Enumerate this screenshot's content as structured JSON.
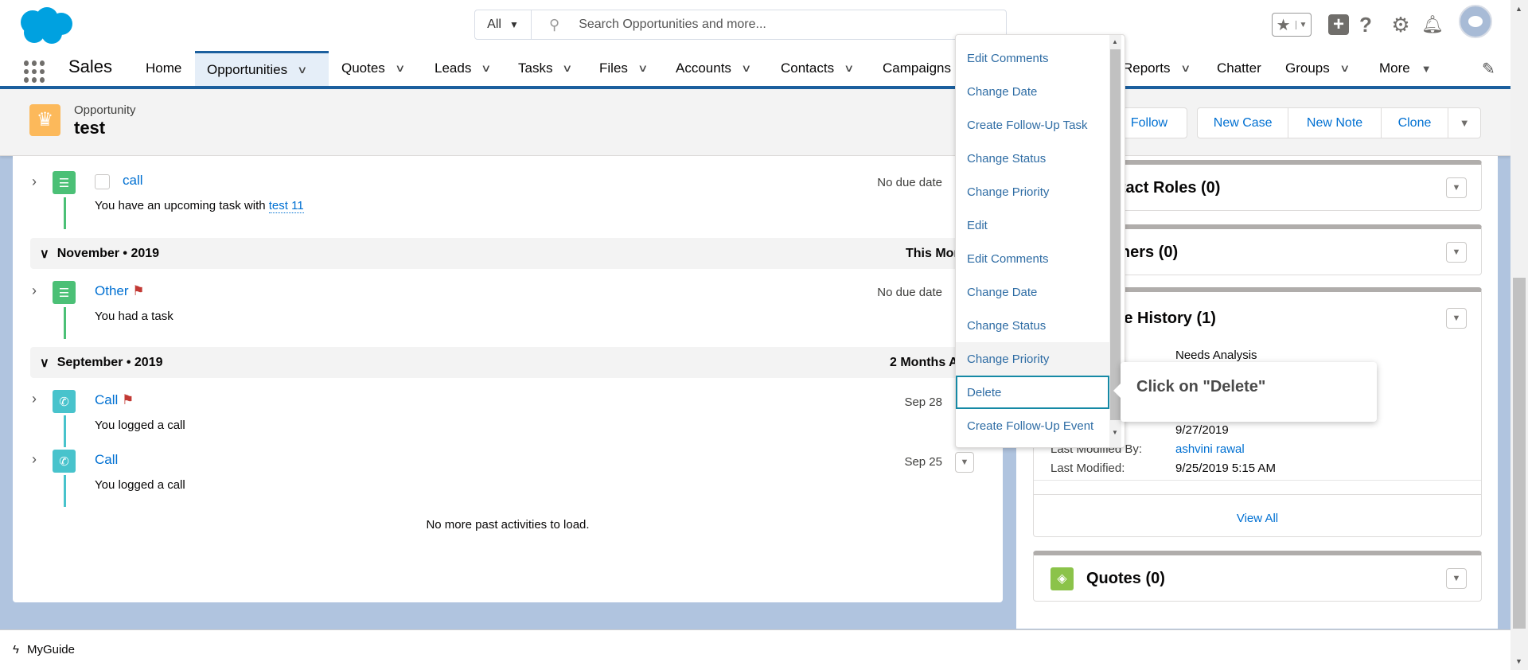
{
  "header": {
    "search_scope": "All",
    "search_placeholder": "Search Opportunities and more...",
    "app_name": "Sales"
  },
  "nav": {
    "items": [
      {
        "label": "Home"
      },
      {
        "label": "Opportunities",
        "active": true
      },
      {
        "label": "Quotes"
      },
      {
        "label": "Leads"
      },
      {
        "label": "Tasks"
      },
      {
        "label": "Files"
      },
      {
        "label": "Accounts"
      },
      {
        "label": "Contacts"
      },
      {
        "label": "Campaigns"
      },
      {
        "label": "Reports"
      },
      {
        "label": "Chatter"
      },
      {
        "label": "Groups"
      },
      {
        "label": "More"
      }
    ]
  },
  "record": {
    "type": "Opportunity",
    "name": "test",
    "actions": {
      "follow": "Follow",
      "new_case": "New Case",
      "new_note": "New Note",
      "clone": "Clone"
    }
  },
  "timeline": {
    "upcoming": [
      {
        "title": "call",
        "detail": "You have an upcoming task with ",
        "link": "test 11",
        "date": "No due date"
      }
    ],
    "groups": [
      {
        "label": "November • 2019",
        "right": "This Month",
        "items": [
          {
            "title": "Other",
            "detail": "You had a task",
            "date": "No due date",
            "flag": true
          }
        ]
      },
      {
        "label": "September • 2019",
        "right": "2 Months Ago",
        "items": [
          {
            "title": "Call",
            "detail": "You logged a call",
            "date": "Sep 28",
            "flag": true
          },
          {
            "title": "Call",
            "detail": "You logged a call",
            "date": "Sep 25"
          }
        ]
      }
    ],
    "end_message": "No more past activities to load."
  },
  "related": {
    "contact_roles": "Contact Roles (0)",
    "partners": "Partners (0)",
    "stage_history": "Stage History (1)",
    "stage_value": "Needs Analysis",
    "close_date": "9/27/2019",
    "last_modified_by_label": "Last Modified By:",
    "last_modified_by": "ashvini rawal",
    "last_modified_label": "Last Modified:",
    "last_modified": "9/25/2019 5:15 AM",
    "view_all": "View All",
    "quotes": "Quotes (0)"
  },
  "menu": {
    "items": [
      "Edit Comments",
      "Change Date",
      "Create Follow-Up Task",
      "Change Status",
      "Change Priority",
      "Edit",
      "Edit Comments",
      "Change Date",
      "Change Status",
      "Change Priority",
      "Delete",
      "Create Follow-Up Event"
    ],
    "hovered": "Change Priority",
    "focused": "Delete"
  },
  "tooltip": {
    "text": "Click on \"Delete\""
  },
  "footer": {
    "label": "MyGuide"
  },
  "colors": {
    "brand": "#00a1e0",
    "link": "#0070d2",
    "nav_accent": "#1b5f9e",
    "task_icon": "#4bc076",
    "call_icon": "#48c3cc",
    "flag": "#c23934",
    "focus": "#1589a5"
  }
}
